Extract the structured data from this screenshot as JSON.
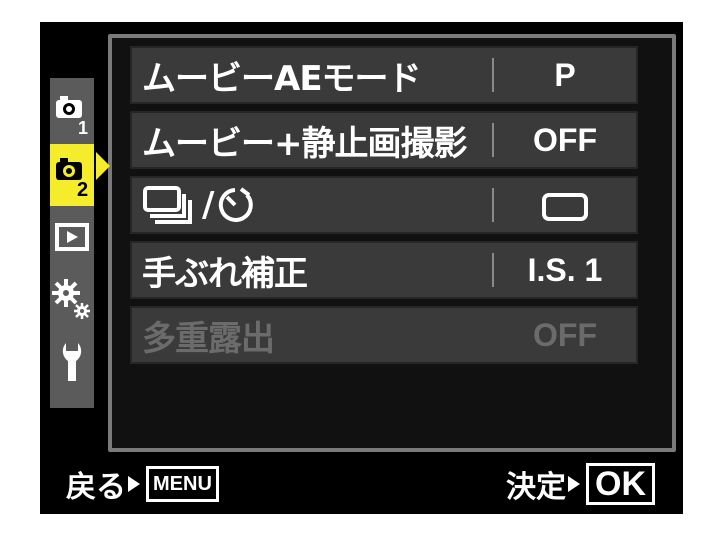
{
  "tabs": [
    {
      "name": "shooting-menu-1",
      "number": "1",
      "active": false
    },
    {
      "name": "shooting-menu-2",
      "number": "2",
      "active": true
    },
    {
      "name": "playback-menu",
      "active": false
    },
    {
      "name": "custom-menu",
      "active": false
    },
    {
      "name": "setup-menu",
      "active": false
    }
  ],
  "rows": [
    {
      "label": "ムービーAEモード",
      "value": "P",
      "enabled": true
    },
    {
      "label": "ムービー+静止画撮影",
      "value": "OFF",
      "enabled": true
    },
    {
      "label": "/",
      "value_icon": "single-frame-icon",
      "label_icons": [
        "sequential-shooting-icon",
        "self-timer-icon"
      ],
      "enabled": true
    },
    {
      "label": "手ぶれ補正",
      "value": "I.S. 1",
      "enabled": true
    },
    {
      "label": "多重露出",
      "value": "OFF",
      "enabled": false
    }
  ],
  "footer": {
    "back_label": "戻る",
    "back_key": "MENU",
    "confirm_label": "決定",
    "confirm_key": "OK"
  },
  "colors": {
    "active_tab": "#f5ec2b",
    "row_bg": "#3a3a3a",
    "disabled_text": "#6b6b6b"
  }
}
